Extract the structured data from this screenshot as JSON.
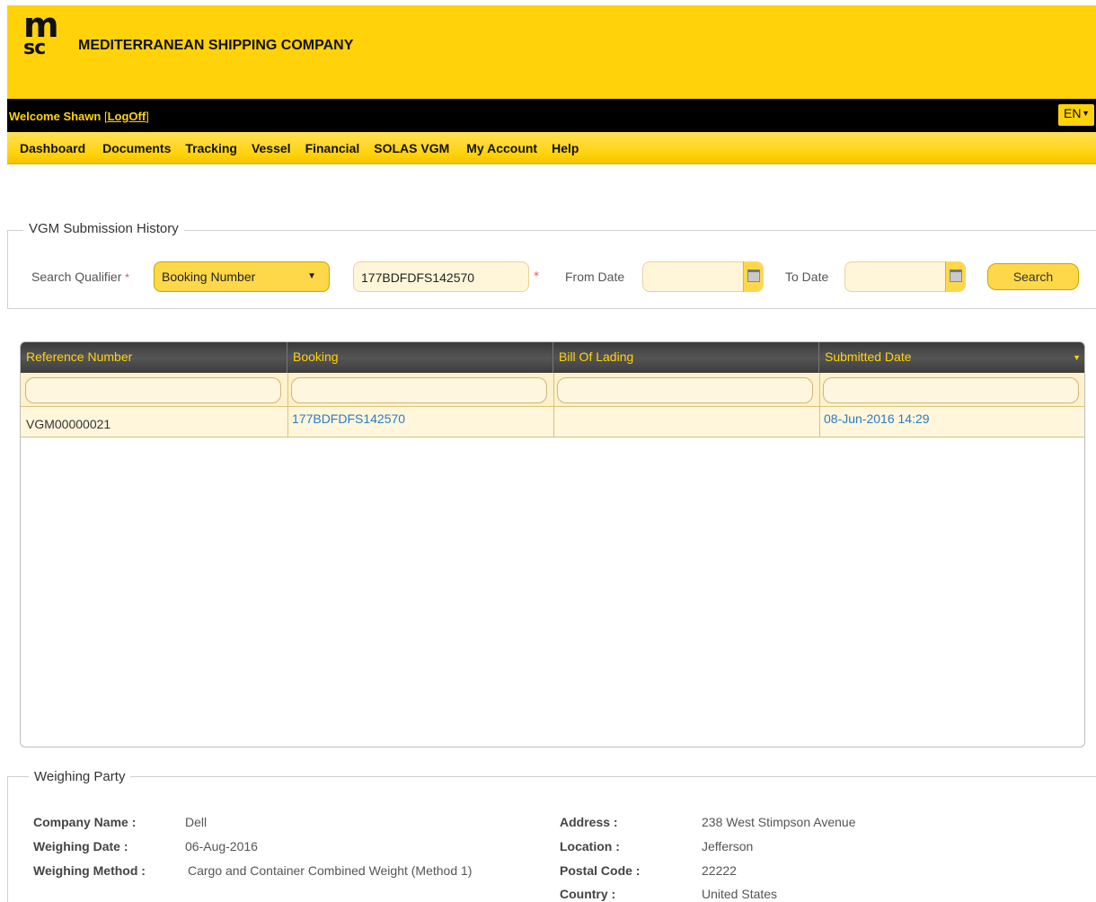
{
  "brand": {
    "logo_top": "m",
    "logo_bottom": "sc",
    "company_name": "MEDITERRANEAN SHIPPING COMPANY"
  },
  "userbar": {
    "welcome": "Welcome Shawn",
    "bracket_open": "[",
    "logoff": "LogOff",
    "bracket_close": "]",
    "language": "EN"
  },
  "nav": {
    "items": [
      "Dashboard",
      "Documents",
      "Tracking",
      "Vessel",
      "Financial",
      "SOLAS VGM",
      "My Account",
      "Help"
    ]
  },
  "search": {
    "section_title": "VGM Submission History",
    "qualifier_label": "Search Qualifier",
    "qualifier_value": "Booking Number",
    "query_value": "177BDFDFS142570",
    "from_date_label": "From Date",
    "to_date_label": "To Date",
    "search_button": "Search",
    "required_mark": "*"
  },
  "grid": {
    "columns": [
      "Reference Number",
      "Booking",
      "Bill Of Lading",
      "Submitted Date"
    ],
    "rows": [
      {
        "reference": "VGM00000021",
        "booking": "177BDFDFS142570",
        "bill_of_lading": "",
        "submitted": "08-Jun-2016 14:29"
      }
    ]
  },
  "weighing_party": {
    "section_title": "Weighing Party",
    "left": [
      {
        "label": "Company Name :",
        "value": "Dell"
      },
      {
        "label": "Weighing Date :",
        "value": "06-Aug-2016"
      },
      {
        "label": "Weighing Method :",
        "value": "Cargo and Container Combined Weight (Method 1)"
      }
    ],
    "right": [
      {
        "label": "Address :",
        "value": "238 West Stimpson Avenue"
      },
      {
        "label": "Location :",
        "value": "Jefferson"
      },
      {
        "label": "Postal Code :",
        "value": "22222"
      },
      {
        "label": "Country :",
        "value": "United States"
      }
    ]
  },
  "colors": {
    "brand_yellow": "#FFD20A",
    "link_blue": "#2a7cc0",
    "grid_header": "#3d3d3d"
  }
}
